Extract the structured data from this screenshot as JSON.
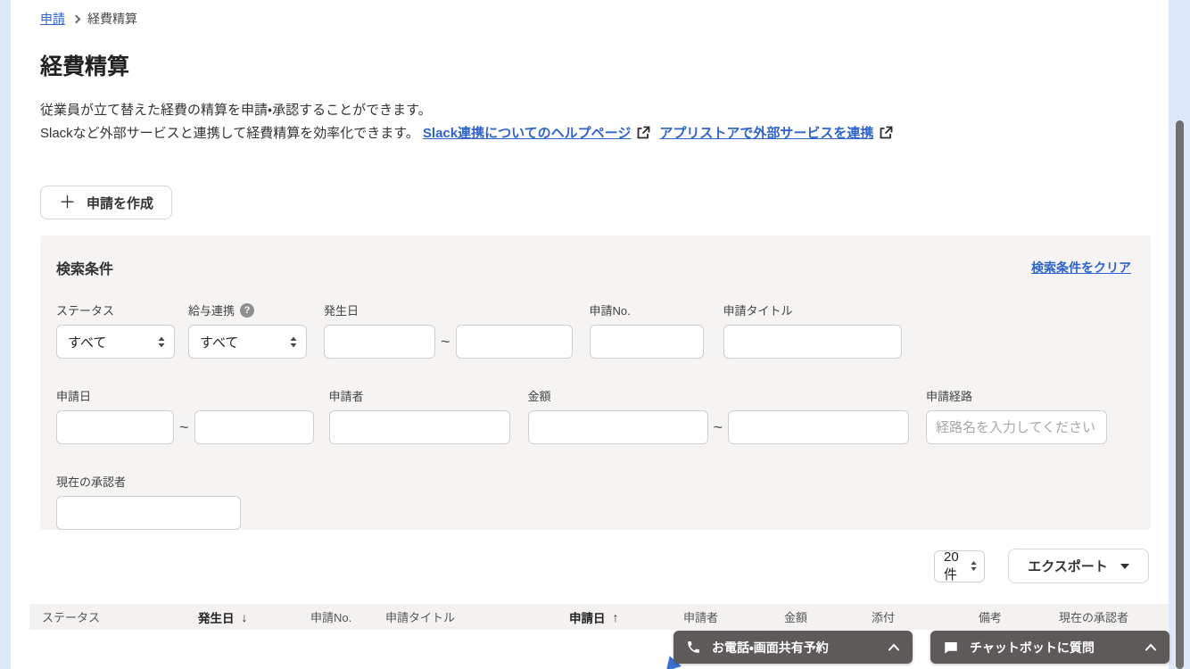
{
  "breadcrumb": {
    "link_label": "申請",
    "current_label": "経費精算"
  },
  "header": {
    "title": "経費精算",
    "description_line1": "従業員が立て替えた経費の精算を申請・承認することができます。",
    "description_line2_prefix": "Slackなど外部サービスと連携して経費精算を効率化できます。",
    "slack_help_link": "Slack連携についてのヘルプページ",
    "appstore_link": "アプリストアで外部サービスを連携",
    "create_button_label": "申請を作成"
  },
  "search_panel": {
    "title": "検索条件",
    "clear_link": "検索条件をクリア",
    "range_separator": "~",
    "status": {
      "label": "ステータス",
      "value": "すべて"
    },
    "payroll_link": {
      "label": "給与連携",
      "value": "すべて"
    },
    "occurrence_date": {
      "label": "発生日"
    },
    "request_no": {
      "label": "申請No."
    },
    "request_title": {
      "label": "申請タイトル"
    },
    "request_date": {
      "label": "申請日"
    },
    "applicant": {
      "label": "申請者"
    },
    "amount": {
      "label": "金額"
    },
    "route": {
      "label": "申請経路",
      "placeholder": "経路名を入力してください"
    },
    "current_approver": {
      "label": "現在の承認者"
    }
  },
  "list_controls": {
    "per_page_value": "20件",
    "export_label": "エクスポート"
  },
  "table": {
    "columns": [
      {
        "label": "ステータス"
      },
      {
        "label": "発生日",
        "sort_icon": "↓"
      },
      {
        "label": "申請No."
      },
      {
        "label": "申請タイトル"
      },
      {
        "label": "申請日",
        "sort_icon": "↑"
      },
      {
        "label": "申請者"
      },
      {
        "label": "金額"
      },
      {
        "label": "添付"
      },
      {
        "label": "備考"
      },
      {
        "label": "現在の承認者"
      }
    ]
  },
  "floating_widgets": {
    "phone_button_label": "お電話・画面共有予約",
    "chat_button_label": "チャットボットに質問"
  },
  "colors": {
    "link_blue": "#2e63cc",
    "page_edge_blue": "#dde9fb",
    "panel_gray": "#f5f4f2",
    "widget_dark": "#5e5a5a"
  }
}
